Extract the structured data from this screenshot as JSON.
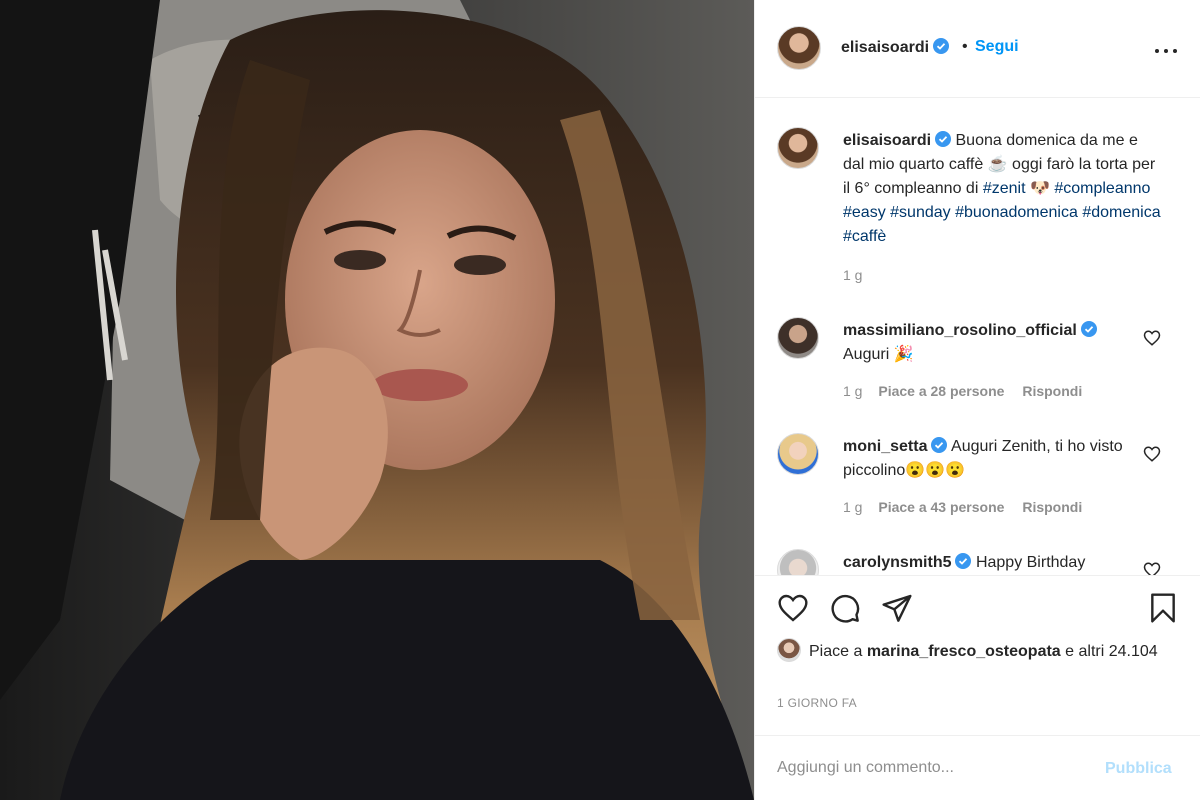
{
  "colors": {
    "link": "#00376b",
    "accent": "#0095f6",
    "muted": "#8e8e8e",
    "verified": "#3897f0",
    "publish_disabled": "#b2dffc"
  },
  "photo": {
    "alt_subject": "selfie"
  },
  "header": {
    "username": "elisaisoardi",
    "dot": "•",
    "follow_label": "Segui",
    "more_icon": "more-horizontal-icon"
  },
  "caption": {
    "username": "elisaisoardi",
    "text_a": "Buona domenica da me e dal mio quarto caffè ☕ oggi farò la torta per il 6° compleanno di ",
    "tag_zenit": "#zenit",
    "emoji_dog": "🐶",
    "tag_compleanno": "#compleanno",
    "tag_easy": "#easy",
    "tag_sunday": "#sunday",
    "tag_buonadomenica": "#buonadomenica",
    "tag_domenica": "#domenica",
    "tag_caffe": "#caffè",
    "time": "1 g"
  },
  "comments": [
    {
      "username": "massimiliano_rosolino_official",
      "text": "Auguri 🎉",
      "time": "1 g",
      "likes": "Piace a 28 persone",
      "reply": "Rispondi"
    },
    {
      "username": "moni_setta",
      "text": "Auguri Zenith, ti ho visto piccolino😮😮😮",
      "time": "1 g",
      "likes": "Piace a 43 persone",
      "reply": "Rispondi"
    },
    {
      "username": "carolynsmith5",
      "text": "Happy Birthday"
    }
  ],
  "actions": {
    "icons": [
      "heart-icon",
      "comment-icon",
      "share-icon",
      "bookmark-icon"
    ],
    "likes_prefix": "Piace a",
    "likes_user": "marina_fresco_osteopata",
    "likes_suffix": "e altri 24.104",
    "time_ago": "1 GIORNO FA"
  },
  "add_comment": {
    "placeholder": "Aggiungi un commento...",
    "publish_label": "Pubblica"
  }
}
